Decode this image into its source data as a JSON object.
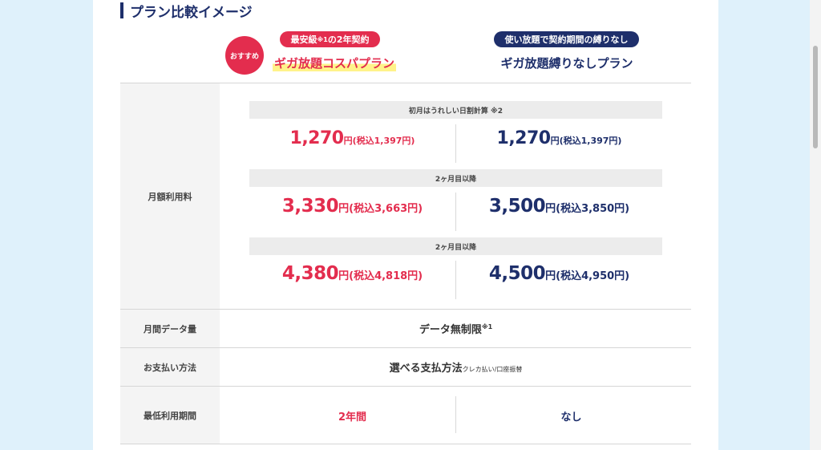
{
  "section": {
    "title": "プラン比較イメージ"
  },
  "header": {
    "recommend_badge": "おすすめ",
    "left_pill_main": "最安級",
    "left_pill_sup": "※1",
    "left_pill_tail": "の2年契約",
    "right_pill": "使い放題で契約期間の縛りなし",
    "left_plan": "ギガ放題コスパプラン",
    "right_plan": "ギガ放題縛りなしプラン"
  },
  "rows": {
    "monthly_fee": {
      "label": "月額利用料",
      "blocks": [
        {
          "subhead": "初月はうれしい日割計算 ※2",
          "left": {
            "num": "1,270",
            "unit": "円(税込1,397円)"
          },
          "right": {
            "num": "1,270",
            "unit": "円(税込1,397円)"
          }
        },
        {
          "subhead": "2ヶ月目以降",
          "left": {
            "num": "3,330",
            "unit": "円(税込3,663円)"
          },
          "right": {
            "num": "3,500",
            "unit": "円(税込3,850円)"
          }
        },
        {
          "subhead": "2ヶ月目以降",
          "left": {
            "num": "4,380",
            "unit": "円(税込4,818円)"
          },
          "right": {
            "num": "4,500",
            "unit": "円(税込4,950円)"
          }
        }
      ]
    },
    "data": {
      "label": "月間データ量",
      "value": "データ無制限",
      "sup": "※1"
    },
    "payment": {
      "label": "お支払い方法",
      "value": "選べる支払方法",
      "note": "クレカ払い/口座振替"
    },
    "min_period": {
      "label": "最低利用期間",
      "left": "2年間",
      "right": "なし"
    }
  },
  "colors": {
    "accent_red": "#e32d4e",
    "accent_navy": "#1e2f6b",
    "background": "#dff1fb"
  }
}
